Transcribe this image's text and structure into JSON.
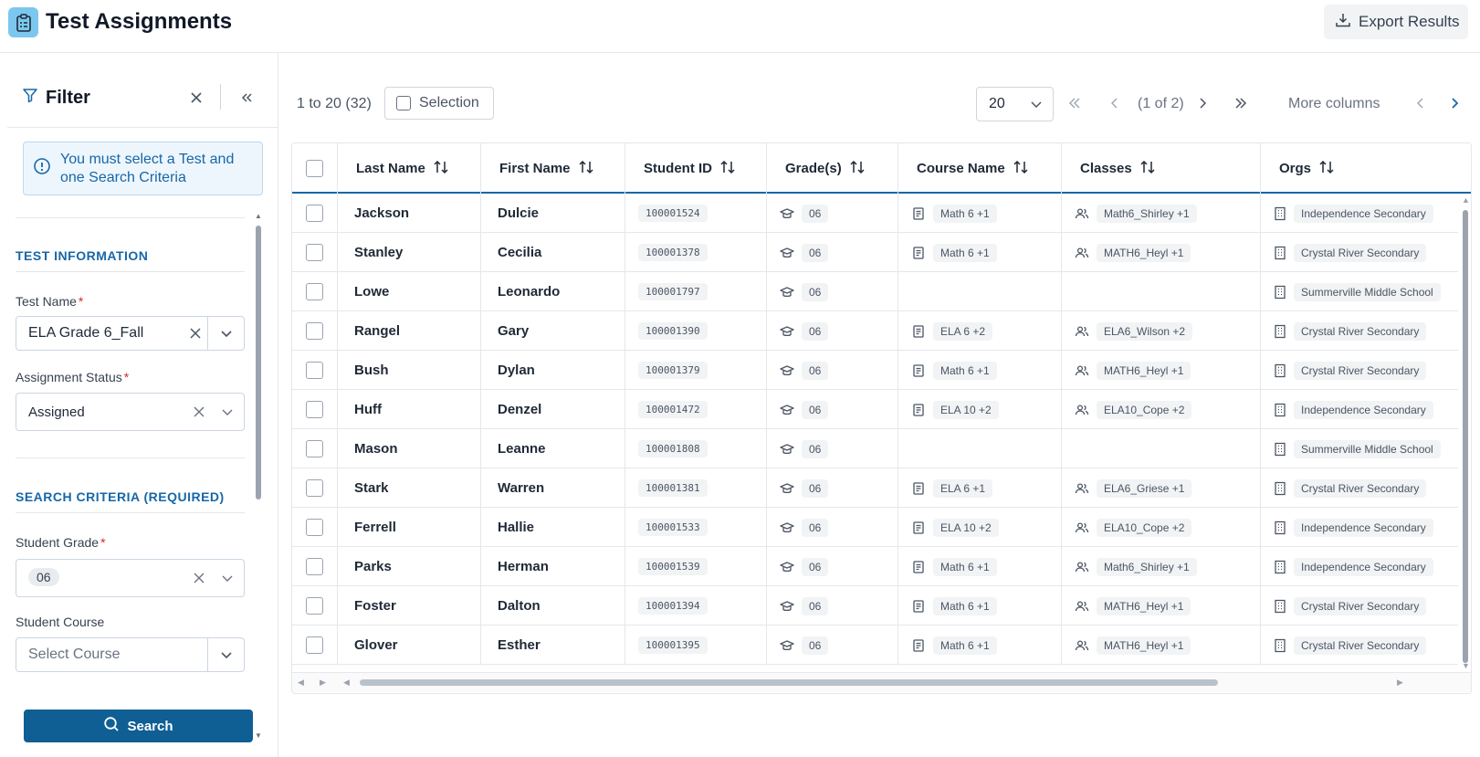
{
  "header": {
    "title": "Test Assignments",
    "export_label": "Export Results"
  },
  "filter": {
    "title": "Filter",
    "alert": "You must select a Test and one Search Criteria",
    "test_info_title": "TEST INFORMATION",
    "test_name_label": "Test Name",
    "test_name_value": "ELA Grade 6_Fall",
    "assignment_status_label": "Assignment Status",
    "assignment_status_value": "Assigned",
    "search_criteria_title": "SEARCH CRITERIA (REQUIRED)",
    "student_grade_label": "Student Grade",
    "student_grade_chip": "06",
    "student_course_label": "Student Course",
    "student_course_placeholder": "Select Course",
    "search_label": "Search",
    "required_mark": "*"
  },
  "toolbar": {
    "range": "1 to 20 (32)",
    "selection_label": "Selection",
    "page_size": "20",
    "page_info": "(1 of 2)",
    "more_columns": "More columns"
  },
  "grid": {
    "columns": [
      "Last Name",
      "First Name",
      "Student ID",
      "Grade(s)",
      "Course Name",
      "Classes",
      "Orgs"
    ],
    "rows": [
      {
        "last": "Jackson",
        "first": "Dulcie",
        "id": "100001524",
        "grade": "06",
        "course": "Math 6 +1",
        "classes": "Math6_Shirley +1",
        "org": "Independence Secondary"
      },
      {
        "last": "Stanley",
        "first": "Cecilia",
        "id": "100001378",
        "grade": "06",
        "course": "Math 6 +1",
        "classes": "MATH6_Heyl +1",
        "org": "Crystal River Secondary"
      },
      {
        "last": "Lowe",
        "first": "Leonardo",
        "id": "100001797",
        "grade": "06",
        "course": "",
        "classes": "",
        "org": "Summerville Middle School"
      },
      {
        "last": "Rangel",
        "first": "Gary",
        "id": "100001390",
        "grade": "06",
        "course": "ELA 6 +2",
        "classes": "ELA6_Wilson +2",
        "org": "Crystal River Secondary"
      },
      {
        "last": "Bush",
        "first": "Dylan",
        "id": "100001379",
        "grade": "06",
        "course": "Math 6 +1",
        "classes": "MATH6_Heyl +1",
        "org": "Crystal River Secondary"
      },
      {
        "last": "Huff",
        "first": "Denzel",
        "id": "100001472",
        "grade": "06",
        "course": "ELA 10 +2",
        "classes": "ELA10_Cope +2",
        "org": "Independence Secondary"
      },
      {
        "last": "Mason",
        "first": "Leanne",
        "id": "100001808",
        "grade": "06",
        "course": "",
        "classes": "",
        "org": "Summerville Middle School"
      },
      {
        "last": "Stark",
        "first": "Warren",
        "id": "100001381",
        "grade": "06",
        "course": "ELA 6 +1",
        "classes": "ELA6_Griese +1",
        "org": "Crystal River Secondary"
      },
      {
        "last": "Ferrell",
        "first": "Hallie",
        "id": "100001533",
        "grade": "06",
        "course": "ELA 10 +2",
        "classes": "ELA10_Cope +2",
        "org": "Independence Secondary"
      },
      {
        "last": "Parks",
        "first": "Herman",
        "id": "100001539",
        "grade": "06",
        "course": "Math 6 +1",
        "classes": "Math6_Shirley +1",
        "org": "Independence Secondary"
      },
      {
        "last": "Foster",
        "first": "Dalton",
        "id": "100001394",
        "grade": "06",
        "course": "Math 6 +1",
        "classes": "MATH6_Heyl +1",
        "org": "Crystal River Secondary"
      },
      {
        "last": "Glover",
        "first": "Esther",
        "id": "100001395",
        "grade": "06",
        "course": "Math 6 +1",
        "classes": "MATH6_Heyl +1",
        "org": "Crystal River Secondary"
      }
    ]
  }
}
